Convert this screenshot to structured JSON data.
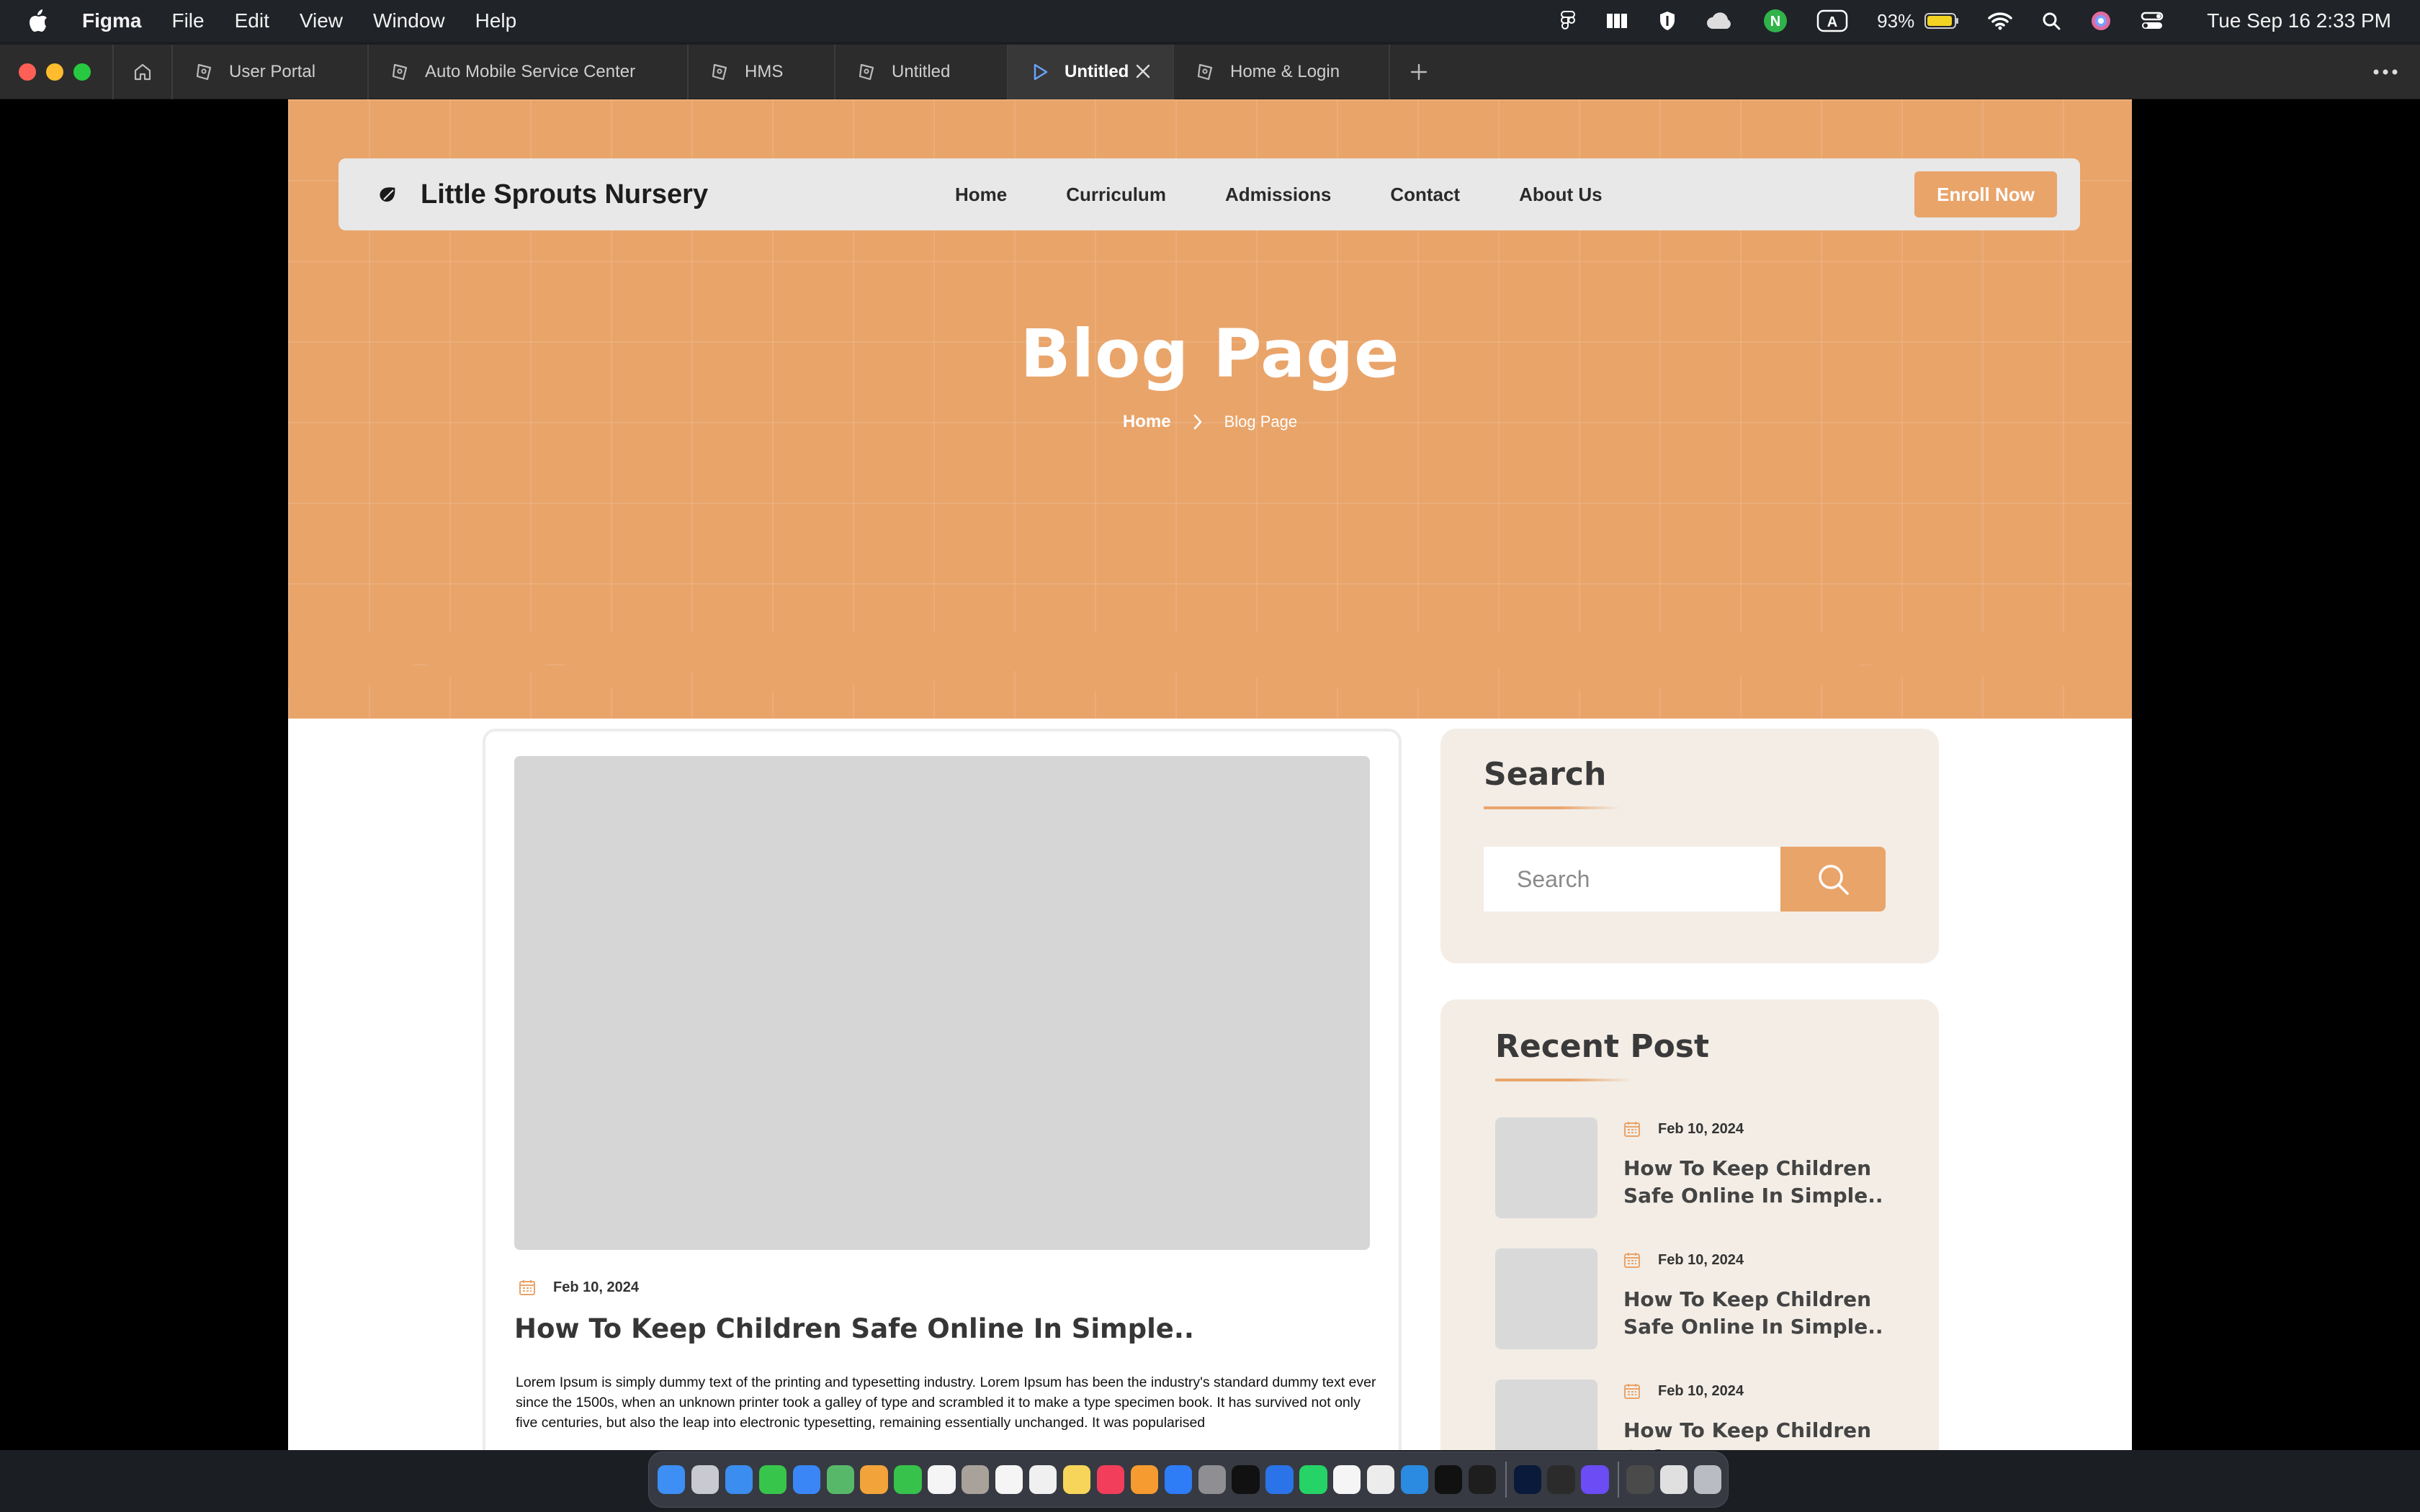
{
  "menubar": {
    "app_name": "Figma",
    "menus": [
      "File",
      "Edit",
      "View",
      "Window",
      "Help"
    ],
    "battery_percent": "93%",
    "datetime": "Tue Sep 16  2:33 PM"
  },
  "tabs": [
    {
      "label": "User Portal",
      "active": false
    },
    {
      "label": "Auto Mobile Service Center",
      "active": false
    },
    {
      "label": "HMS",
      "active": false
    },
    {
      "label": "Untitled",
      "active": false
    },
    {
      "label": "Untitled",
      "active": true
    },
    {
      "label": "Home & Login",
      "active": false
    }
  ],
  "site": {
    "brand": "Little Sprouts Nursery",
    "nav": [
      "Home",
      "Curriculum",
      "Admissions",
      "Contact",
      "About Us"
    ],
    "cta": "Enroll Now",
    "hero_title": "Blog Page",
    "breadcrumb": {
      "home": "Home",
      "current": "Blog Page"
    }
  },
  "post": {
    "date": "Feb 10, 2024",
    "title": "How To Keep Children Safe Online In Simple..",
    "excerpt": "Lorem Ipsum is simply dummy text of the printing and typesetting industry. Lorem Ipsum has been the industry's standard dummy text ever since the 1500s, when an unknown printer took a galley of type and scrambled it to make a type specimen book. It has survived not only five centuries, but also the leap into electronic typesetting, remaining essentially unchanged. It was popularised"
  },
  "sidebar": {
    "search_title": "Search",
    "search_placeholder": "Search",
    "recent_title": "Recent Post",
    "recent_posts": [
      {
        "date": "Feb 10, 2024",
        "title": "How To Keep Children Safe Online In Simple.."
      },
      {
        "date": "Feb 10, 2024",
        "title": "How To Keep Children Safe Online In Simple.."
      },
      {
        "date": "Feb 10, 2024",
        "title": "How To Keep Children Safe"
      }
    ]
  },
  "colors": {
    "accent": "#e9a46a",
    "sidebar_bg": "#f3ede6",
    "placeholder": "#d6d6d6"
  },
  "dock_icons": [
    "finder-icon",
    "launchpad-icon",
    "safari-icon",
    "messages-icon",
    "mail-icon",
    "maps-icon",
    "photos-icon",
    "facetime-icon",
    "calendar-icon",
    "contacts-icon",
    "reminders-icon",
    "freeform-icon",
    "notes-icon",
    "music-icon",
    "pages-icon",
    "app-store-icon",
    "system-settings-icon",
    "tv-icon",
    "keynote-icon",
    "whatsapp-icon",
    "textedit-icon",
    "chatgpt-icon",
    "vscode-icon",
    "notion-icon",
    "figma-icon",
    "photoshop-icon",
    "terminal-icon",
    "arc-icon",
    "downloads-icon",
    "documents-icon",
    "trash-icon"
  ]
}
